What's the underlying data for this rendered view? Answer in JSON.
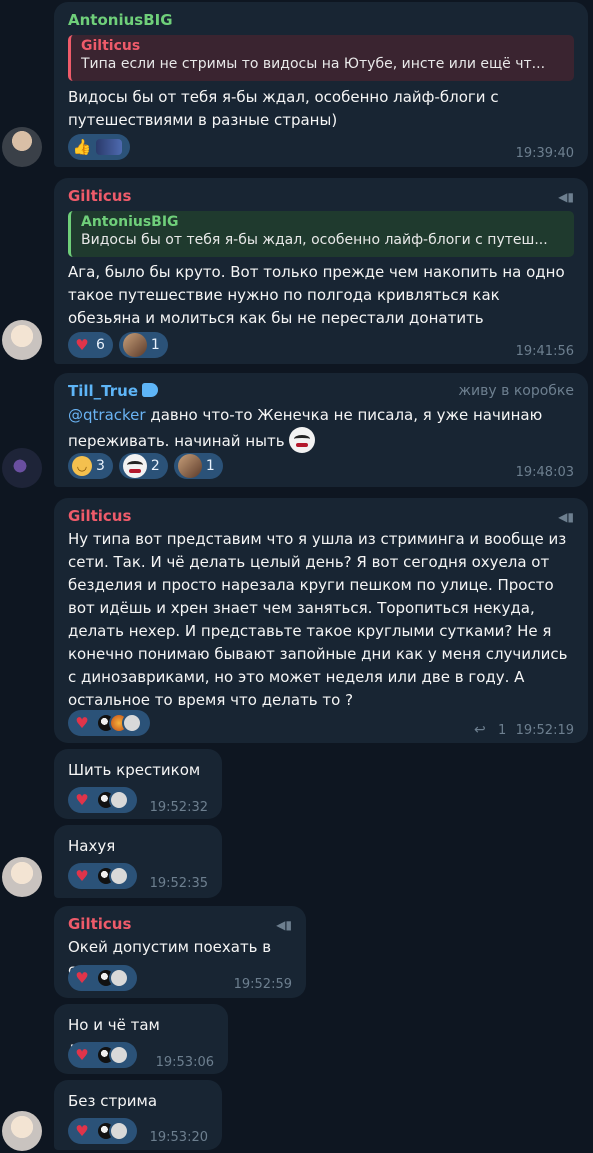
{
  "messages": [
    {
      "author": "AntoniusBIG",
      "quote": {
        "author": "Gilticus",
        "text": "Типа если не стримы то видосы на Ютубе, инсте или ещё чт..."
      },
      "text": "Видосы бы от тебя я-бы ждал, особенно лайф-блоги с путешествиями в разные страны)",
      "reactions": [
        {
          "emoji": "thumbs-up-icon",
          "glyph": "👍"
        },
        {
          "emoji": "car-icon"
        }
      ],
      "time": "19:39:40"
    },
    {
      "author": "Gilticus",
      "quote": {
        "author": "AntoniusBIG",
        "text": "Видосы бы от тебя я-бы ждал, особенно лайф-блоги с путеш..."
      },
      "text": "Ага, было бы круто. Вот только прежде чем накопить на одно такое путешествие нужно по полгода кривляться как обезьяна и молиться как бы не перестали донатить",
      "reactions": [
        {
          "emoji": "heart-icon",
          "glyph": "♥",
          "count": "6"
        },
        {
          "emoji": "custom-face-icon",
          "count": "1"
        }
      ],
      "time": "19:41:56"
    },
    {
      "author": "Till_True",
      "rank": "живу в коробке",
      "mention": "@qtracker",
      "text": " давно что-то Женечка не писала, я уже начинаю переживать. начинай ныть",
      "reactions": [
        {
          "emoji": "grin-icon",
          "glyph": "😁",
          "count": "3"
        },
        {
          "emoji": "joker-icon",
          "count": "2"
        },
        {
          "emoji": "custom-face-icon",
          "count": "1"
        }
      ],
      "time": "19:48:03"
    },
    {
      "author": "Gilticus",
      "text": "Ну типа вот представим что я ушла из стриминга и вообще из сети. Так. И чё делать целый день?  Я вот сегодня охуела от безделия и просто нарезала круги пешком по улице. Просто вот идёшь и хрен знает чем заняться. Торопиться некуда, делать нехер. И представьте такое круглыми сутками? Не я конечно понимаю бывают запойные дни как у меня случились с динозавриками, но это может неделя или две в году. А остальное то время что делать то ?",
      "reactions": [
        {
          "emoji": "heart-icon",
          "glyph": "♥"
        }
      ],
      "replies": "1",
      "time": "19:52:19"
    },
    {
      "text": "Шить крестиком",
      "reactions": [
        {
          "emoji": "heart-icon",
          "glyph": "♥"
        }
      ],
      "time": "19:52:32"
    },
    {
      "text": "Нахуя",
      "reactions": [
        {
          "emoji": "heart-icon",
          "glyph": "♥"
        }
      ],
      "time": "19:52:35"
    },
    {
      "author": "Gilticus",
      "text": "Окей допустим поехать в сад",
      "reactions": [
        {
          "emoji": "heart-icon",
          "glyph": "♥"
        }
      ],
      "time": "19:52:59"
    },
    {
      "text": "Но и чё там делать",
      "reactions": [
        {
          "emoji": "heart-icon",
          "glyph": "♥"
        }
      ],
      "time": "19:53:06"
    },
    {
      "text": "Без стрима",
      "reactions": [
        {
          "emoji": "heart-icon",
          "glyph": "♥"
        }
      ],
      "time": "19:53:20"
    }
  ],
  "colors": {
    "background": "#0e1621",
    "bubble": "#182533",
    "reaction": "#2b5278",
    "green_name": "#6fcf7a",
    "red_name": "#ef5b6a",
    "blue_name": "#5eb5f7"
  }
}
